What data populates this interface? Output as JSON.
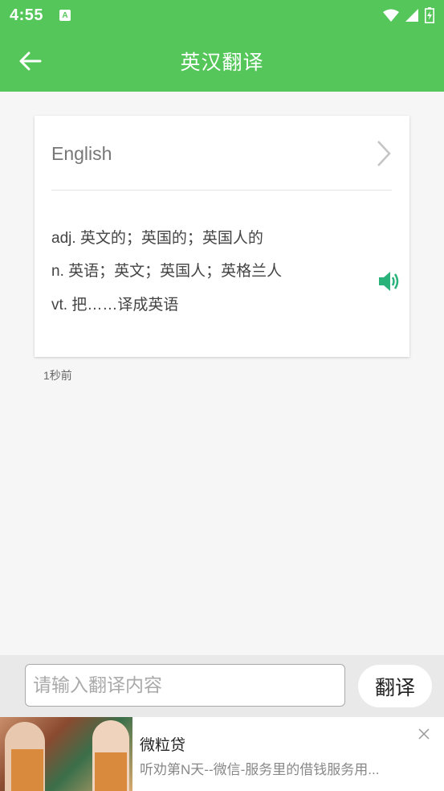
{
  "status_bar": {
    "time": "4:55",
    "app_icon_letter": "A"
  },
  "header": {
    "title": "英汉翻译"
  },
  "result": {
    "word": "English",
    "definitions": [
      "adj. 英文的；英国的；英国人的",
      "n. 英语；英文；英国人；英格兰人",
      "vt. 把……译成英语"
    ],
    "timestamp": "1秒前"
  },
  "input": {
    "value": "",
    "placeholder": "请输入翻译内容",
    "button_label": "翻译"
  },
  "ad": {
    "title": "微粒贷",
    "description": "听劝第N天--微信-服务里的借钱服务用..."
  },
  "colors": {
    "primary": "#55c75a",
    "speaker": "#2ab27b"
  },
  "icons": [
    "back-arrow-icon",
    "chevron-right-icon",
    "speaker-icon",
    "close-icon",
    "wifi-icon",
    "signal-icon",
    "battery-icon"
  ]
}
